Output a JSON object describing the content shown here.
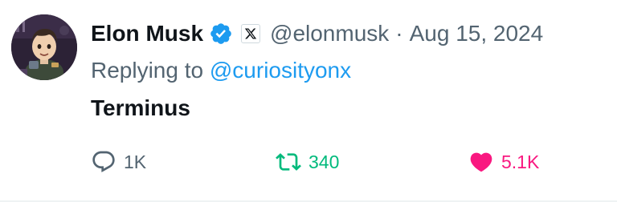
{
  "tweet": {
    "author_name": "Elon Musk",
    "handle": "@elonmusk",
    "separator": "·",
    "date": "Aug 15, 2024",
    "replying_prefix": "Replying to",
    "replying_to": "@curiosityonx",
    "text": "Terminus"
  },
  "badges": {
    "verified_icon": "verified-badge-icon",
    "affiliate_icon": "x-logo-icon"
  },
  "actions": {
    "reply": {
      "icon": "reply-bubble-icon",
      "count": "1K"
    },
    "retweet": {
      "icon": "retweet-icon",
      "count": "340"
    },
    "like": {
      "icon": "heart-icon",
      "count": "5.1K"
    }
  },
  "colors": {
    "text_primary": "#0f1419",
    "text_secondary": "#536471",
    "link": "#1d9bf0",
    "retweet_active": "#00ba7c",
    "like_active": "#f91880",
    "verified": "#1d9bf0"
  }
}
